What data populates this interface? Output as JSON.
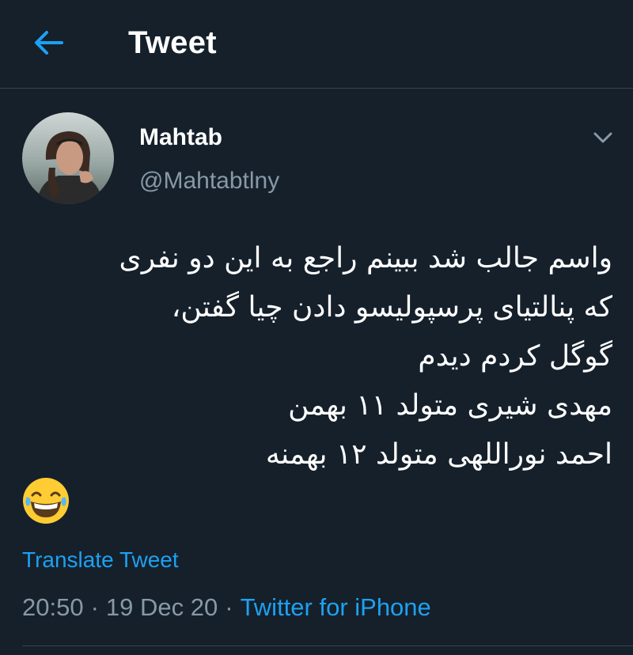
{
  "header": {
    "title": "Tweet",
    "back_icon": "arrow-left-icon"
  },
  "author": {
    "display_name": "Mahtab",
    "handle": "@Mahtabtlny",
    "avatar_icon": "avatar-photo"
  },
  "menu_icon": "chevron-down-icon",
  "tweet": {
    "lines": [
      "واسم جالب شد ببینم راجع به این دو نفری",
      "که پنالتیای پرسپولیسو دادن چیا گفتن،",
      "گوگل کردم دیدم",
      "مهدی شیری متولد ۱۱ بهمن",
      "احمد نوراللهی متولد ۱۲ بهمنه"
    ],
    "emoji": "😂"
  },
  "translate_label": "Translate Tweet",
  "meta": {
    "time": "20:50",
    "separator": "·",
    "date": "19 Dec 20",
    "source": "Twitter for iPhone"
  },
  "colors": {
    "background": "#15202b",
    "accent": "#1da1f2",
    "secondary_text": "#8899a6",
    "divider": "#38444d"
  }
}
